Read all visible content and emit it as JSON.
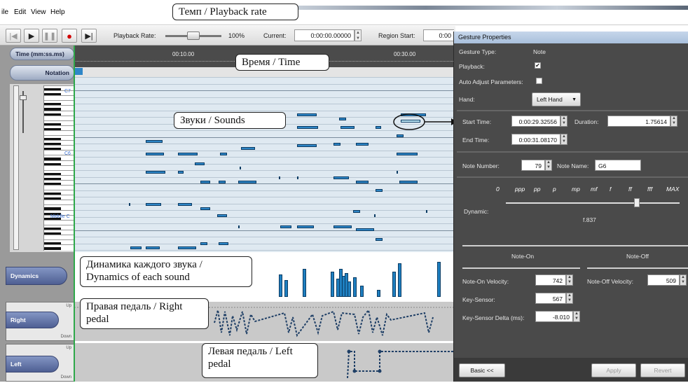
{
  "menu": [
    "ile",
    "Edit",
    "View",
    "Help"
  ],
  "toolbar": {
    "playback_rate_label": "Playback Rate:",
    "playback_rate_value": "100%",
    "playback_rate_fraction": 0.5,
    "current_label": "Current:",
    "current_value": "0:00:00.00000",
    "region_start_label": "Region Start:",
    "region_start_value": "0:00"
  },
  "left_panel": {
    "time_header": "Time (mm:ss.ms)",
    "notation_button": "Notation",
    "dynamics_tab": "Dynamics",
    "right_tab": "Right",
    "left_tab": "Left",
    "up_label": "Up",
    "down_label": "Down",
    "piano_labels": [
      "C7",
      "C6",
      "Middle C"
    ]
  },
  "ruler": {
    "ticks": [
      "00:10.00",
      "00:30.00"
    ]
  },
  "callouts": {
    "tempo": "Темп / Playback rate",
    "time": "Время / Time",
    "sounds": "Звуки / Sounds",
    "dynamics": "Динамика каждого звука / Dynamics of each sound",
    "right_pedal": "Правая педаль / Right pedal",
    "left_pedal": "Левая педаль / Left pedal"
  },
  "properties": {
    "title": "Gesture Properties",
    "gesture_type_label": "Gesture Type:",
    "gesture_type_value": "Note",
    "playback_label": "Playback:",
    "playback_checked": true,
    "auto_adjust_label": "Auto Adjust Parameters:",
    "auto_adjust_checked": false,
    "hand_label": "Hand:",
    "hand_value": "Left Hand",
    "start_time_label": "Start Time:",
    "start_time_value": "0:00:29.32556",
    "duration_label": "Duration:",
    "duration_value": "1.75614",
    "end_time_label": "End Time:",
    "end_time_value": "0:00:31.08170",
    "note_number_label": "Note Number:",
    "note_number_value": "79",
    "note_name_label": "Note Name:",
    "note_name_value": "G6",
    "dynamic_label": "Dynamic:",
    "dynamic_marks": [
      "0",
      "ppp",
      "pp",
      "p",
      "mp",
      "mf",
      "f",
      "ff",
      "fff",
      "MAX"
    ],
    "dynamic_value": "f.837",
    "note_on_header": "Note-On",
    "note_off_header": "Note-Off",
    "note_on_velocity_label": "Note-On Velocity:",
    "note_on_velocity_value": "742",
    "note_off_velocity_label": "Note-Off Velocity:",
    "note_off_velocity_value": "509",
    "key_sensor_label": "Key-Sensor:",
    "key_sensor_value": "567",
    "key_sensor_delta_label": "Key-Sensor Delta (ms):",
    "key_sensor_delta_value": "-8.010",
    "basic_button": "Basic <<",
    "apply_button": "Apply",
    "revert_button": "Revert"
  }
}
